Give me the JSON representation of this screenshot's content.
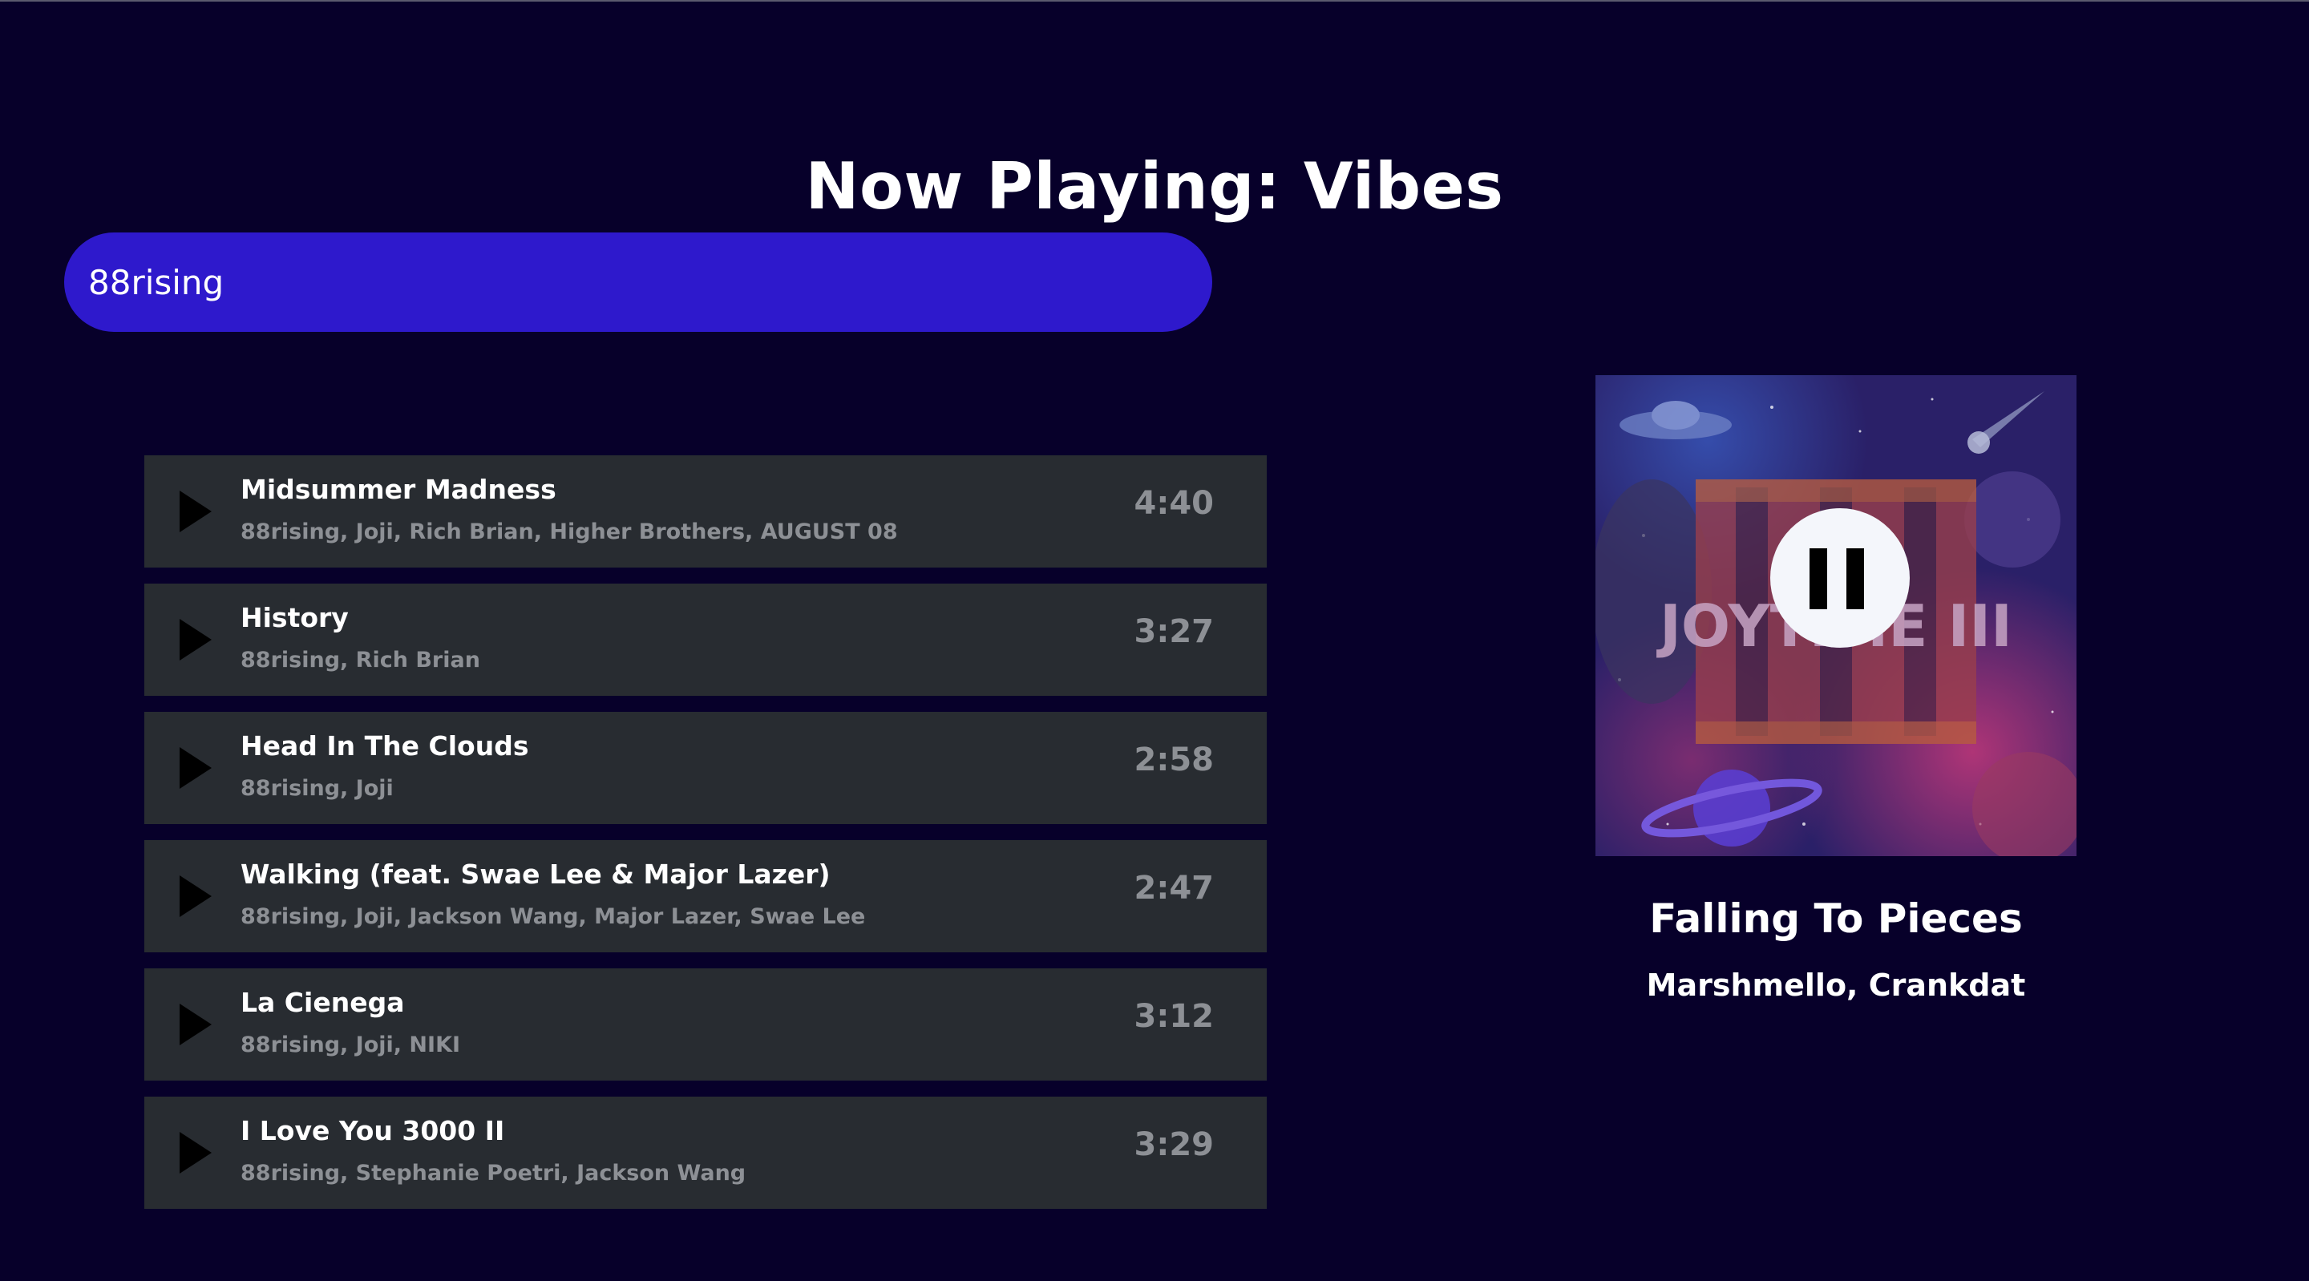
{
  "header": {
    "title": "Now Playing: Vibes"
  },
  "search": {
    "value": "88rising"
  },
  "tracks": [
    {
      "title": "Midsummer Madness",
      "artists": "88rising, Joji, Rich Brian, Higher Brothers, AUGUST 08",
      "duration": "4:40"
    },
    {
      "title": "History",
      "artists": "88rising, Rich Brian",
      "duration": "3:27"
    },
    {
      "title": "Head In The Clouds",
      "artists": "88rising, Joji",
      "duration": "2:58"
    },
    {
      "title": "Walking (feat. Swae Lee & Major Lazer)",
      "artists": "88rising, Joji, Jackson Wang, Major Lazer, Swae Lee",
      "duration": "2:47"
    },
    {
      "title": "La Cienega",
      "artists": "88rising, Joji, NIKI",
      "duration": "3:12"
    },
    {
      "title": "I Love You 3000 II",
      "artists": "88rising, Stephanie Poetri, Jackson Wang",
      "duration": "3:29"
    }
  ],
  "now_playing": {
    "title": "Falling To Pieces",
    "artist": "Marshmello, Crankdat",
    "album_art_text": "JOYTIME III",
    "state": "playing"
  },
  "icons": {
    "track_play": "play-icon",
    "player_control": "pause-icon"
  },
  "colors": {
    "background": "#07002a",
    "search_bar": "#2e19cc",
    "track_row": "#282c31",
    "secondary_text": "#8d9095"
  }
}
